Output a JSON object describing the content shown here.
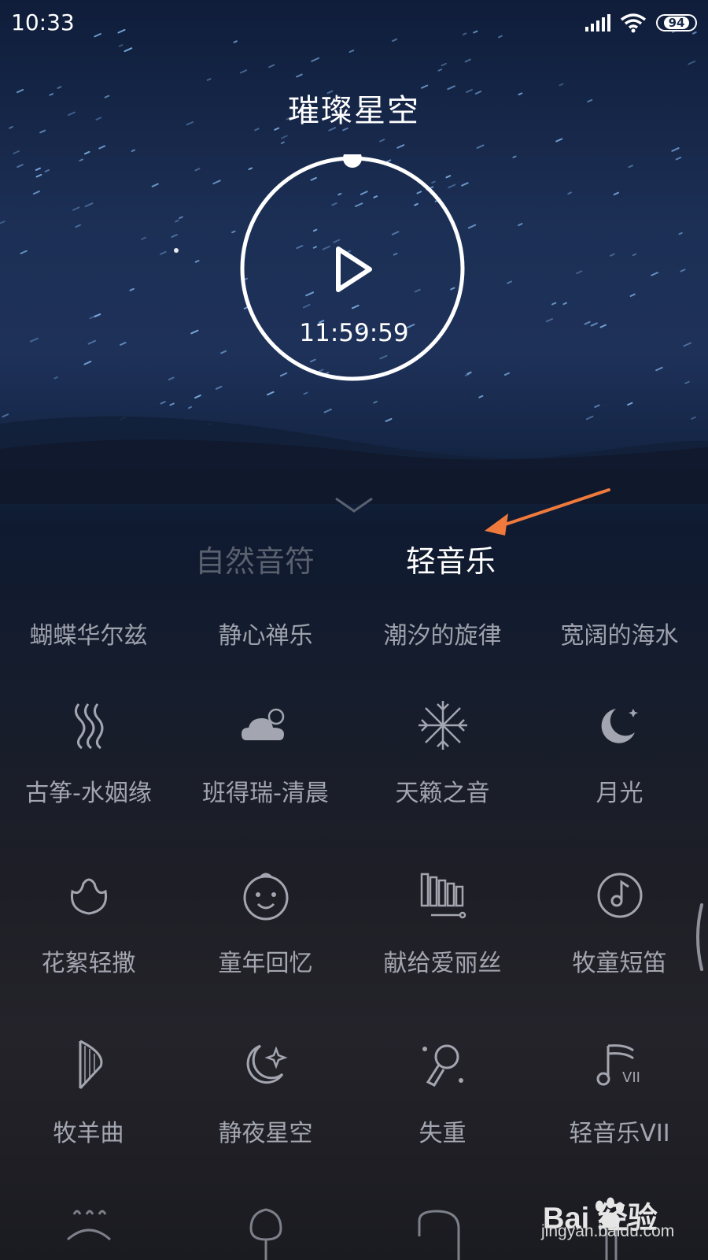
{
  "status_bar": {
    "time": "10:33",
    "battery": "94"
  },
  "header": {
    "title": "璀璨星空"
  },
  "player": {
    "timer": "11:59:59"
  },
  "tabs": [
    {
      "label": "自然音符",
      "active": false
    },
    {
      "label": "轻音乐",
      "active": true
    }
  ],
  "top_row": [
    "蝴蝶华尔兹",
    "静心禅乐",
    "潮汐的旋律",
    "宽阔的海水"
  ],
  "tracks": [
    {
      "label": "古筝-水姻缘",
      "icon": "zither-icon"
    },
    {
      "label": "班得瑞-清晨",
      "icon": "cloud-sun-icon"
    },
    {
      "label": "天籁之音",
      "icon": "snowflake-icon"
    },
    {
      "label": "月光",
      "icon": "moon-icon"
    },
    {
      "label": "花絮轻撒",
      "icon": "flower-icon"
    },
    {
      "label": "童年回忆",
      "icon": "child-face-icon"
    },
    {
      "label": "献给爱丽丝",
      "icon": "xylophone-icon"
    },
    {
      "label": "牧童短笛",
      "icon": "music-disc-icon"
    },
    {
      "label": "牧羊曲",
      "icon": "harp-icon"
    },
    {
      "label": "静夜星空",
      "icon": "moon-star-icon"
    },
    {
      "label": "失重",
      "icon": "astronaut-icon"
    },
    {
      "label": "轻音乐VII",
      "icon": "music-note-vii-icon"
    }
  ],
  "watermark": {
    "brand": "Bai 经验",
    "url": "jingyan.baidu.com"
  },
  "colors": {
    "accent_arrow": "#f07a3c",
    "inactive_text": "#59606e",
    "label_text": "#a3a6b0"
  }
}
